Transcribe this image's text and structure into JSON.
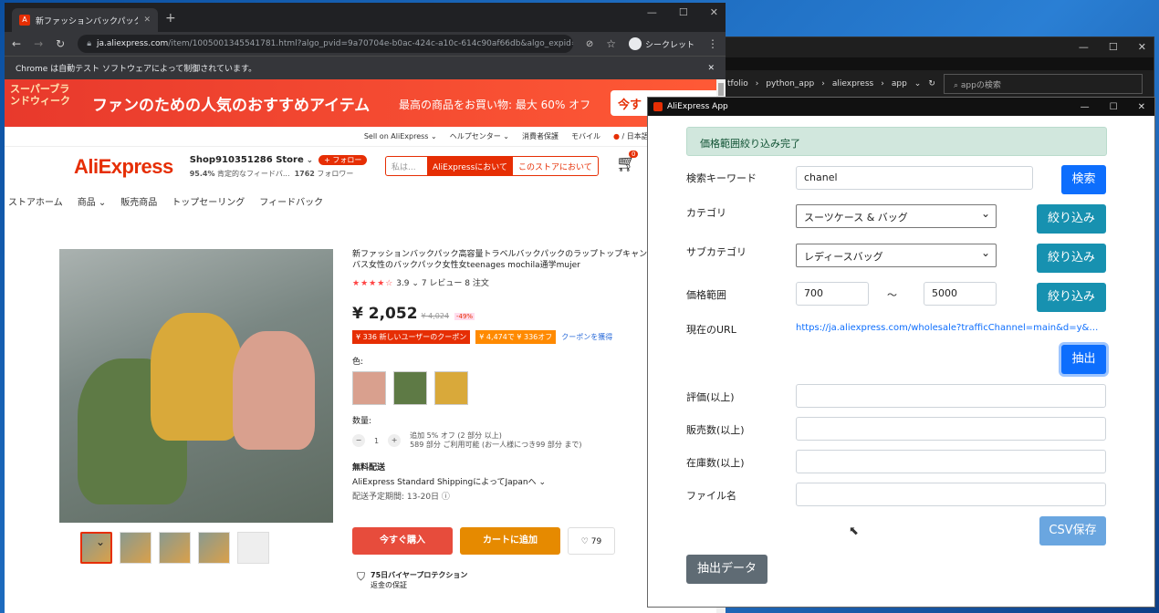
{
  "explorer": {
    "path": [
      "tfolio",
      "python_app",
      "aliexpress",
      "app"
    ],
    "search_placeholder": "appの検索"
  },
  "chrome": {
    "tab_title": "新ファッションバックパック高容量トラベ",
    "url_host": "ja.aliexpress.com",
    "url_rest": "/item/1005001345541781.html?algo_pvid=9a70704e-b0ac-424c-a10c-614c90af66db&algo_expid=9a70704e-b0ac-...",
    "incognito_label": "シークレット",
    "infobar_text": "Chrome は自動テスト ソフトウェアによって制御されています。"
  },
  "banner": {
    "event": "スーパーブランドウィーク",
    "headline": "ファンのための人気のおすすめアイテム",
    "sub": "最高の商品をお買い物: 最大 60% オフ",
    "cta": "今す"
  },
  "topnav": [
    "Sell on AliExpress ⌄",
    "ヘルプセンター ⌄",
    "消費者保護",
    "モバイル",
    "/ 日本語 / JPY ⌄"
  ],
  "store": {
    "logo": "AliExpress",
    "name": "Shop910351286 Store",
    "follow": "+ フォロー",
    "rating": "95.4%",
    "rating_text": "肯定的なフィードバ...",
    "followers": "1762",
    "followers_label": "フォロワー",
    "search_placeholder": "私は...",
    "search_all": "AliExpressにおいて",
    "search_store": "このストアにおいて",
    "cart_count": "0"
  },
  "storenav": [
    "ストアホーム",
    "商品 ⌄",
    "販売商品",
    "トップセーリング",
    "フィードバック"
  ],
  "product": {
    "title": "新ファッションバックパック高容量トラベルバックパックのラップトップキャンバス女性のバックパック女性女teenages mochila通学mujer",
    "stars": "★★★★☆",
    "rating": "3.9 ⌄",
    "reviews": "7 レビュー",
    "orders": "8 注文",
    "price": "¥ 2,052",
    "old_price": "¥ 4,024",
    "discount": "-49%",
    "coupon1": "¥ 336 新しいユーザーのクーポン",
    "coupon2": "¥ 4,474で ¥ 336オフ",
    "coupon_link": "クーポンを獲得",
    "color_label": "色:",
    "qty_label": "数量:",
    "qty": "1",
    "qty_note1": "追加 5% オフ (2 部分 以上)",
    "qty_note2": "589 部分 ご利用可能 (お一人様につき99 部分 まで)",
    "ship_label": "無料配送",
    "ship_text": "AliExpress Standard ShippingによってJapanへ ⌄",
    "ship_date": "配送予定期間: 13-20日",
    "buy_now": "今すぐ購入",
    "add_cart": "カートに追加",
    "wish_count": "79",
    "protect_title": "75日バイヤープロテクション",
    "protect_sub": "返金の保証"
  },
  "app": {
    "title": "AliExpress App",
    "alert": "価格範囲絞り込み完了",
    "keyword_label": "検索キーワード",
    "keyword_value": "chanel",
    "search_btn": "検索",
    "category_label": "カテゴリ",
    "category_value": "スーツケース & バッグ",
    "filter_btn": "絞り込み",
    "subcategory_label": "サブカテゴリ",
    "subcategory_value": "レディースバッグ",
    "price_label": "価格範囲",
    "price_min": "700",
    "price_sep": "〜",
    "price_max": "5000",
    "url_label": "現在のURL",
    "url_value": "https://ja.aliexpress.com/wholesale?trafficChannel=main&d=y&CatId...",
    "extract_btn": "抽出",
    "rating_label": "評価(以上)",
    "sales_label": "販売数(以上)",
    "stock_label": "在庫数(以上)",
    "file_label": "ファイル名",
    "csv_btn": "CSV保存",
    "data_btn": "抽出データ"
  }
}
